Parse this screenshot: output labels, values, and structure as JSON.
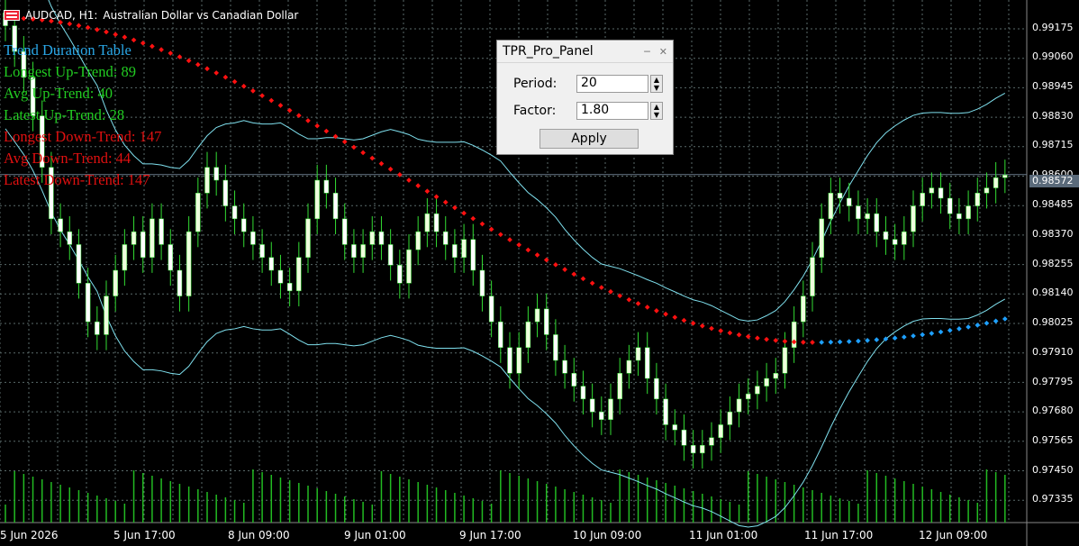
{
  "header": {
    "symbol": "AUDCAD, H1:",
    "description": "Australian Dollar vs Canadian Dollar"
  },
  "trend_table": {
    "title": "Trend Duration Table",
    "rows": [
      {
        "text": "Longest Up-Trend: 89",
        "color": "#22cc22"
      },
      {
        "text": "Avg Up-Trend: 40",
        "color": "#22cc22"
      },
      {
        "text": "Latest Up-Trend: 28",
        "color": "#22cc22"
      },
      {
        "text": "Longest Down-Trend: 147",
        "color": "#e01010"
      },
      {
        "text": "Avg Down-Trend: 44",
        "color": "#e01010"
      },
      {
        "text": "Latest Down-Trend: 147",
        "color": "#e01010"
      }
    ],
    "title_color": "#2aa8e8"
  },
  "panel": {
    "title": "TPR_Pro_Panel",
    "minimize_icon": "minimize-icon",
    "close_icon": "close-icon",
    "period_label": "Period:",
    "period_value": "20",
    "factor_label": "Factor:",
    "factor_value": "1.80",
    "apply_label": "Apply"
  },
  "price_axis": {
    "labels": [
      "0.99175",
      "0.99060",
      "0.98945",
      "0.98830",
      "0.98715",
      "0.98600",
      "0.98485",
      "0.98370",
      "0.98255",
      "0.98140",
      "0.98025",
      "0.97910",
      "0.97795",
      "0.97680",
      "0.97565",
      "0.97450",
      "0.97335"
    ],
    "current": "0.98572"
  },
  "time_axis": {
    "labels": [
      "5 Jun 2026",
      "5 Jun 17:00",
      "8 Jun 09:00",
      "9 Jun 01:00",
      "9 Jun 17:00",
      "10 Jun 09:00",
      "11 Jun 01:00",
      "11 Jun 17:00",
      "12 Jun 09:00"
    ]
  },
  "colors": {
    "candle_bull": "#eeffdd",
    "candle_bear": "#ffffff",
    "wick": "#33dd33",
    "band": "#7fe0ee",
    "trend_down": "#ff1111",
    "trend_up": "#1ea0ff",
    "volume": "#22bb22",
    "grid": "#5a6a6a"
  },
  "chart_data": {
    "type": "candlestick",
    "symbol": "AUDCAD",
    "timeframe": "H1",
    "ylim": [
      0.9722,
      0.9925
    ],
    "close_series_approx": [
      0.9915,
      0.9905,
      0.9895,
      0.988,
      0.986,
      0.984,
      0.9835,
      0.983,
      0.9815,
      0.98,
      0.9795,
      0.981,
      0.982,
      0.983,
      0.9835,
      0.9825,
      0.984,
      0.983,
      0.982,
      0.981,
      0.9835,
      0.985,
      0.986,
      0.9855,
      0.9845,
      0.984,
      0.9835,
      0.983,
      0.9825,
      0.982,
      0.9815,
      0.9812,
      0.9825,
      0.984,
      0.9855,
      0.985,
      0.984,
      0.983,
      0.9825,
      0.983,
      0.9835,
      0.983,
      0.9822,
      0.9815,
      0.9828,
      0.9835,
      0.9842,
      0.9835,
      0.983,
      0.9825,
      0.9832,
      0.982,
      0.981,
      0.98,
      0.979,
      0.978,
      0.979,
      0.98,
      0.9805,
      0.9795,
      0.9785,
      0.978,
      0.9775,
      0.977,
      0.9765,
      0.9762,
      0.977,
      0.978,
      0.9785,
      0.979,
      0.9778,
      0.977,
      0.976,
      0.9758,
      0.9752,
      0.9749,
      0.9752,
      0.9755,
      0.976,
      0.9765,
      0.977,
      0.9772,
      0.9775,
      0.9778,
      0.978,
      0.979,
      0.98,
      0.981,
      0.9825,
      0.984,
      0.985,
      0.9848,
      0.9845,
      0.984,
      0.9842,
      0.9835,
      0.9832,
      0.983,
      0.9835,
      0.9845,
      0.985,
      0.9852,
      0.9848,
      0.9842,
      0.984,
      0.9845,
      0.985,
      0.9852,
      0.9856,
      0.9857
    ],
    "trend_line_down_start": 0.9918,
    "trend_line_down_end": 0.9792,
    "trend_line_up_start": 0.9792,
    "trend_line_up_end": 0.9802
  }
}
